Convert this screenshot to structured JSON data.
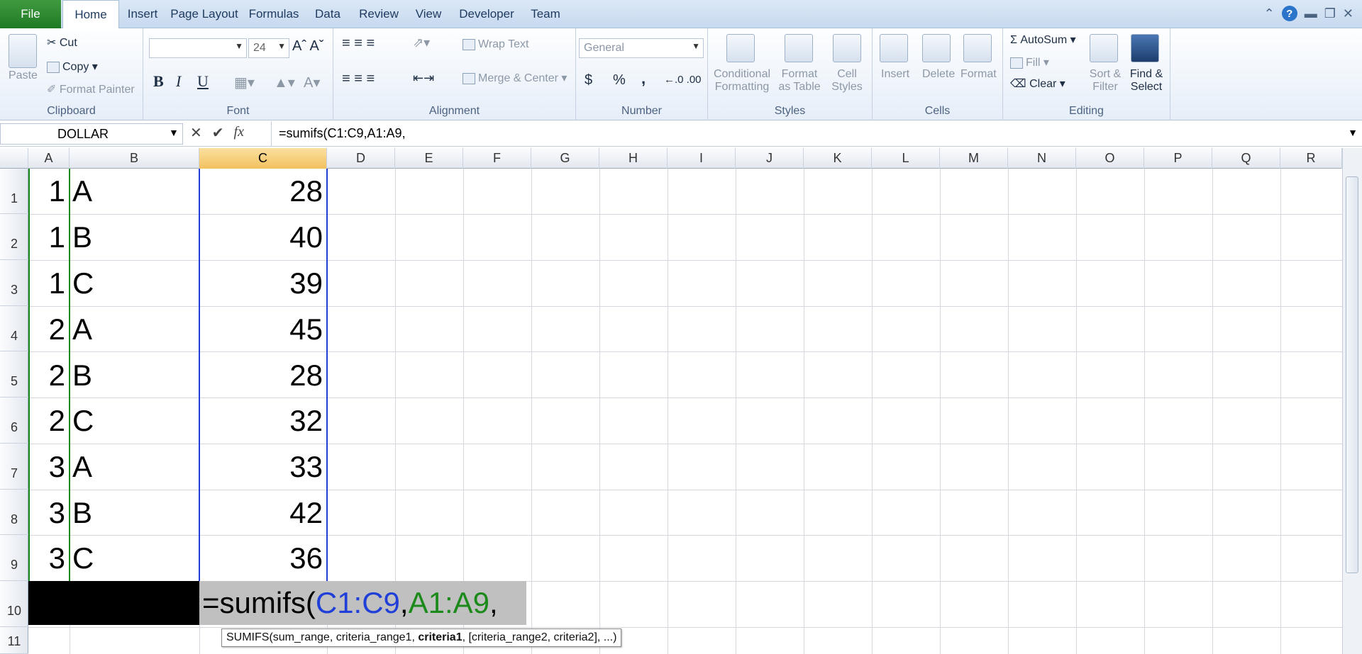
{
  "tabs": {
    "file": "File",
    "items": [
      "Home",
      "Insert",
      "Page Layout",
      "Formulas",
      "Data",
      "Review",
      "View",
      "Developer",
      "Team"
    ]
  },
  "ribbon": {
    "clipboard": {
      "paste": "Paste",
      "cut": "Cut",
      "copy": "Copy",
      "format_painter": "Format Painter",
      "label": "Clipboard"
    },
    "font": {
      "size": "24",
      "bold": "B",
      "italic": "I",
      "underline": "U",
      "label": "Font"
    },
    "alignment": {
      "wrap": "Wrap Text",
      "merge": "Merge & Center",
      "label": "Alignment"
    },
    "number": {
      "format": "General",
      "currency": "$",
      "percent": "%",
      "comma": ",",
      "label": "Number"
    },
    "styles": {
      "conditional": "Conditional",
      "conditional2": "Formatting",
      "format_table": "Format",
      "format_table2": "as Table",
      "cell_styles": "Cell",
      "cell_styles2": "Styles",
      "label": "Styles"
    },
    "cells": {
      "insert": "Insert",
      "delete": "Delete",
      "format": "Format",
      "label": "Cells"
    },
    "editing": {
      "autosum": "AutoSum",
      "fill": "Fill",
      "clear": "Clear",
      "sort": "Sort &",
      "sort2": "Filter",
      "find": "Find &",
      "find2": "Select",
      "label": "Editing"
    }
  },
  "formula_bar": {
    "name_box": "DOLLAR",
    "fx": "fx",
    "formula": "=sumifs(C1:C9,A1:A9,"
  },
  "columns": [
    "A",
    "B",
    "C",
    "D",
    "E",
    "F",
    "G",
    "H",
    "I",
    "J",
    "K",
    "L",
    "M",
    "N",
    "O",
    "P",
    "Q",
    "R"
  ],
  "rows": [
    "1",
    "2",
    "3",
    "4",
    "5",
    "6",
    "7",
    "8",
    "9",
    "10",
    "11"
  ],
  "cells": [
    {
      "a": "1",
      "b": "A",
      "c": "28"
    },
    {
      "a": "1",
      "b": "B",
      "c": "40"
    },
    {
      "a": "1",
      "b": "C",
      "c": "39"
    },
    {
      "a": "2",
      "b": "A",
      "c": "45"
    },
    {
      "a": "2",
      "b": "B",
      "c": "28"
    },
    {
      "a": "2",
      "b": "C",
      "c": "32"
    },
    {
      "a": "3",
      "b": "A",
      "c": "33"
    },
    {
      "a": "3",
      "b": "B",
      "c": "42"
    },
    {
      "a": "3",
      "b": "C",
      "c": "36"
    }
  ],
  "edit_cell": {
    "prefix": "=sumifs(",
    "range1": "C1:C9",
    "sep1": ",",
    "range2": "A1:A9",
    "sep2": ","
  },
  "tooltip": {
    "a": "SUMIFS(sum_range, criteria_range1, ",
    "b": "criteria1",
    "c": ", [criteria_range2, criteria2], ...)"
  },
  "colors": {
    "range1": "#1f3fd8",
    "range2": "#1b8a1b",
    "selected_header": "#f3c15e"
  }
}
